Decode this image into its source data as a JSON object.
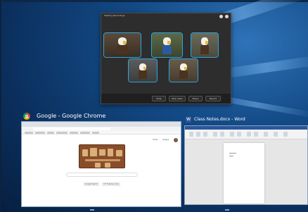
{
  "meeting": {
    "title": "Meeting Recordings",
    "toolbar": [
      "Mute",
      "Stop video",
      "Share",
      "Record"
    ]
  },
  "chrome": {
    "title": "Google - Google Chrome",
    "top_links": [
      "Gmail",
      "Images"
    ],
    "search_button": "Google Search",
    "lucky_button": "I'm Feeling Lucky"
  },
  "word": {
    "title": "Class Notes.docx - Word"
  },
  "colors": {
    "tile_border": "#2aa6e0",
    "word_blue": "#2b579a",
    "desktop_blue": "#134a86"
  }
}
